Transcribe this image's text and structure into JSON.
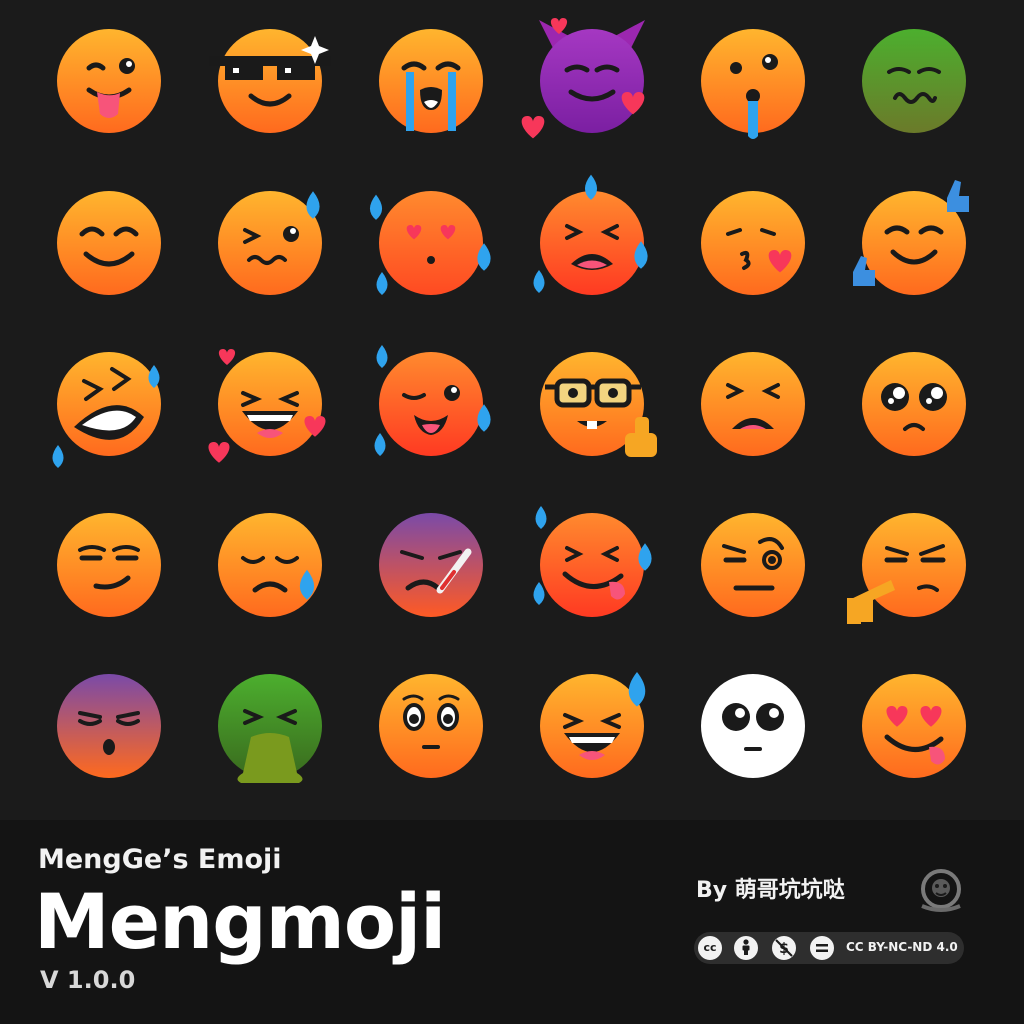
{
  "emojis": [
    {
      "name": "tongue-wink"
    },
    {
      "name": "sunglasses-cool"
    },
    {
      "name": "crying"
    },
    {
      "name": "devil-hearts"
    },
    {
      "name": "drooling"
    },
    {
      "name": "sick-green"
    },
    {
      "name": "smiling-blush"
    },
    {
      "name": "woozy-sweat"
    },
    {
      "name": "heart-eyes-sweat"
    },
    {
      "name": "angry-sweat"
    },
    {
      "name": "kissing-heart"
    },
    {
      "name": "thumbs-up-smile"
    },
    {
      "name": "rofl"
    },
    {
      "name": "laughing-hearts"
    },
    {
      "name": "winking-sweat"
    },
    {
      "name": "nerd-pointing"
    },
    {
      "name": "tired-squint"
    },
    {
      "name": "pleading"
    },
    {
      "name": "smirk"
    },
    {
      "name": "sad-sweat"
    },
    {
      "name": "thermometer-sick"
    },
    {
      "name": "yum-sweat"
    },
    {
      "name": "raised-eyebrow"
    },
    {
      "name": "thinking-point"
    },
    {
      "name": "pensive-gloom"
    },
    {
      "name": "vomiting"
    },
    {
      "name": "blushing-shy"
    },
    {
      "name": "grin-sweat"
    },
    {
      "name": "white-pleading"
    },
    {
      "name": "heart-eyes-tongue"
    }
  ],
  "footer": {
    "subtitle": "MengGe’s Emoji",
    "title": "Mengmoji",
    "version": "V 1.0.0",
    "author": "By 萌哥坑坑哒",
    "license": "CC BY-NC-ND 4.0",
    "license_icons": [
      "cc",
      "by",
      "nc",
      "nd"
    ]
  },
  "colors": {
    "background": "#1b1b1b",
    "footer_bg": "#141414",
    "face_top": "#ffb52e",
    "face_bottom": "#ff6a1e",
    "sweat": "#2fa3ee",
    "heart": "#f7375a",
    "devil": "#9c27b0",
    "sick": "#4caf2e"
  }
}
